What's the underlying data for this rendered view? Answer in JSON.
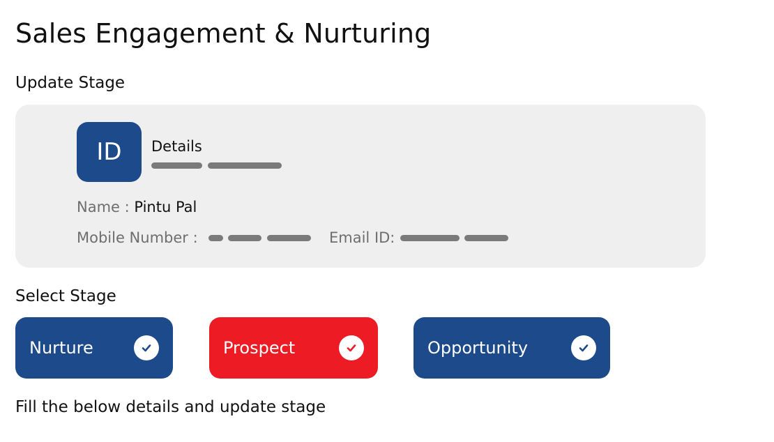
{
  "page": {
    "title": "Sales Engagement & Nurturing",
    "update_stage_heading": "Update Stage",
    "select_stage_heading": "Select Stage",
    "instruction": "Fill the below details and update stage"
  },
  "details_card": {
    "badge_text": "ID",
    "details_label": "Details",
    "name_label": "Name : ",
    "name_value": "Pintu Pal",
    "mobile_label": "Mobile Number : ",
    "email_label": "Email ID: "
  },
  "stages": [
    {
      "label": "Nurture",
      "color": "#1c4a8a",
      "checked": true,
      "icon": "check-circle-icon"
    },
    {
      "label": "Prospect",
      "color": "#ed1c24",
      "checked": true,
      "icon": "check-circle-icon"
    },
    {
      "label": "Opportunity",
      "color": "#1c4a8a",
      "checked": true,
      "icon": "check-circle-icon"
    }
  ],
  "colors": {
    "primary_blue": "#1c4a8a",
    "prospect_red": "#ed1c24",
    "card_background": "#efefef",
    "masked_text": "#7a7a7a"
  }
}
